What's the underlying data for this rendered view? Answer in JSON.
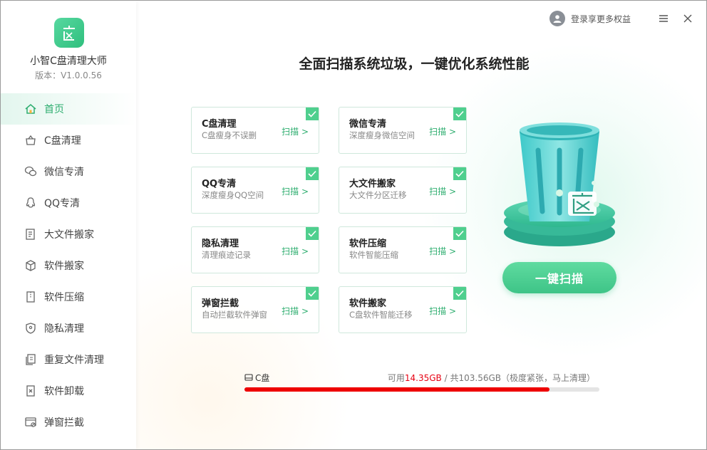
{
  "app": {
    "name": "小智C盘清理大师",
    "version": "版本：V1.0.0.56",
    "brand_color": "#3ec487"
  },
  "sidebar": {
    "items": [
      {
        "label": "首页",
        "icon": "home-icon",
        "active": true
      },
      {
        "label": "C盘清理",
        "icon": "basket-icon"
      },
      {
        "label": "微信专清",
        "icon": "wechat-icon"
      },
      {
        "label": "QQ专清",
        "icon": "qq-icon"
      },
      {
        "label": "大文件搬家",
        "icon": "document-list-icon"
      },
      {
        "label": "软件搬家",
        "icon": "box-icon"
      },
      {
        "label": "软件压缩",
        "icon": "zip-file-icon"
      },
      {
        "label": "隐私清理",
        "icon": "shield-icon"
      },
      {
        "label": "重复文件清理",
        "icon": "duplicate-files-icon"
      },
      {
        "label": "软件卸载",
        "icon": "uninstall-icon"
      },
      {
        "label": "弹窗拦截",
        "icon": "popup-block-icon"
      }
    ]
  },
  "topbar": {
    "login_text": "登录享更多权益"
  },
  "main": {
    "headline": "全面扫描系统垃圾，一键优化系统性能",
    "cards": [
      {
        "title": "C盘清理",
        "sub": "C盘瘦身不误删",
        "action": "扫描 >",
        "checked": true
      },
      {
        "title": "微信专清",
        "sub": "深度瘦身微信空间",
        "action": "扫描 >",
        "checked": true
      },
      {
        "title": "QQ专清",
        "sub": "深度瘦身QQ空间",
        "action": "扫描 >",
        "checked": true
      },
      {
        "title": "大文件搬家",
        "sub": "大文件分区迁移",
        "action": "扫描 >",
        "checked": true
      },
      {
        "title": "隐私清理",
        "sub": "清理痕迹记录",
        "action": "扫描 >",
        "checked": true
      },
      {
        "title": "软件压缩",
        "sub": "软件智能压缩",
        "action": "扫描 >",
        "checked": true
      },
      {
        "title": "弹窗拦截",
        "sub": "自动拦截软件弹窗",
        "action": "扫描 >",
        "checked": true
      },
      {
        "title": "软件搬家",
        "sub": "C盘软件智能迁移",
        "action": "扫描 >",
        "checked": true
      }
    ],
    "scan_button": "一键扫描"
  },
  "disk": {
    "name": "C盘",
    "available_prefix": "可用",
    "available": "14.35GB",
    "total_text": " /  共103.56GB（极度紧张，马上清理）",
    "used_fraction": 0.86,
    "warn_color": "#ee0000"
  }
}
